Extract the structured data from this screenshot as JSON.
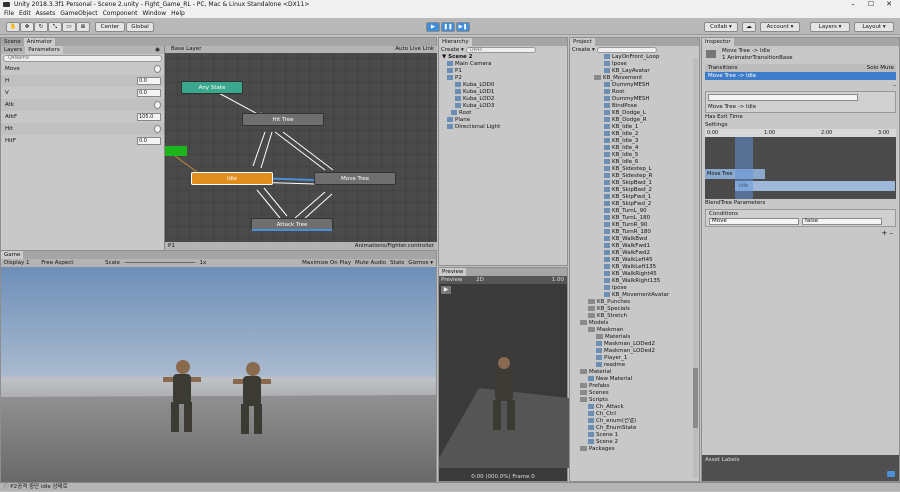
{
  "window": {
    "title": "Unity 2018.3.3f1 Personal - Scene 2.unity - Fight_Game_RL - PC, Mac & Linux Standalone <DX11>",
    "min": "–",
    "max": "☐",
    "close": "✕"
  },
  "menu": [
    "File",
    "Edit",
    "Assets",
    "GameObject",
    "Component",
    "Window",
    "Help"
  ],
  "toolbar": {
    "center": "Center",
    "global": "Global",
    "collab": "Collab ▾",
    "account": "Account ▾",
    "layers": "Layers ▾",
    "layout": "Layout ▾"
  },
  "animator": {
    "tabs": [
      "Scene",
      "Animator"
    ],
    "sub_tabs": [
      "Layers",
      "Parameters"
    ],
    "search_placeholder": "Q▾Name",
    "base_layer": "Base Layer",
    "auto_live": "Auto Live Link",
    "path": "P1",
    "controller": "Animations/Fighter.controller",
    "params": [
      {
        "name": "Move",
        "value": ""
      },
      {
        "name": "H",
        "value": "0.0"
      },
      {
        "name": "V",
        "value": "0.0"
      },
      {
        "name": "Atk",
        "value": ""
      },
      {
        "name": "AtkF",
        "value": "105.0"
      },
      {
        "name": "Hit",
        "value": ""
      },
      {
        "name": "HitF",
        "value": "0.0"
      }
    ],
    "nodes": {
      "any": "Any State",
      "hit": "Hit Tree",
      "idle": "Idle",
      "move": "Move Tree",
      "attack": "Attack Tree"
    }
  },
  "game": {
    "tab": "Game",
    "display": "Display 1",
    "aspect": "Free Aspect",
    "scale": "Scale",
    "scale_val": "1x",
    "opts": [
      "Maximize On Play",
      "Mute Audio",
      "Stats",
      "Gizmos ▾"
    ]
  },
  "hierarchy": {
    "tab": "Hierarchy",
    "create": "Create ▾",
    "search": "Q▾All",
    "scene": "Scene 2",
    "items": [
      "Main Camera",
      "P1",
      "P2",
      "Kuba_LOD0",
      "Kuba_LOD1",
      "Kuba_LOD2",
      "Kuba_LOD3",
      "Root",
      "Plane",
      "Directional Light"
    ]
  },
  "preview": {
    "tab": "Preview",
    "label": "Preview",
    "mode": "2D",
    "speed": "1.00",
    "status": "0:00 (000.0%) Frame 0"
  },
  "project": {
    "tab": "Project",
    "create": "Create ▾",
    "items": [
      "LayOnFront_Loop",
      "Ipose",
      "KB_LayAvatar",
      "KB_Movement",
      "DummyMESH",
      "Root",
      "DummyMESH",
      "BindPose",
      "KB_Dodge_L",
      "KB_Dodge_R",
      "KB_Idle_1",
      "KB_Idle_2",
      "KB_Idle_3",
      "KB_Idle_4",
      "KB_Idle_5",
      "KB_Idle_6",
      "KB_Sidestep_L",
      "KB_Sidestep_R",
      "KB_SkipBwd_1",
      "KB_SkipBwd_2",
      "KB_SkipFwd_1",
      "KB_SkipFwd_2",
      "KB_TurnL_90",
      "KB_TurnL_180",
      "KB_TurnR_90",
      "KB_TurnR_180",
      "KB_WalkBwd",
      "KB_WalkFwd1",
      "KB_WalkFwd2",
      "KB_WalkLeft45",
      "KB_WalkLeft135",
      "KB_WalkRight45",
      "KB_WalkRight135",
      "Ipose",
      "KB_MovementAvatar",
      "KB_Punches",
      "KB_Specials",
      "KB_Stretch",
      "Models",
      "Maskman",
      "Materials",
      "Maskman_LODed2",
      "Maskman_LODed2",
      "Player_1",
      "readme",
      "Material",
      "New Material",
      "Prefabs",
      "Scenes",
      "Scripts",
      "Ch_Attack",
      "Ch_Ctrl",
      "Ch_enum(전열)",
      "Ch_EnumState",
      "Scene 1",
      "Scene 2",
      "Packages"
    ]
  },
  "inspector": {
    "tab": "Inspector",
    "title": "Move Tree -> Idle",
    "subtitle": "1 AnimatorTransitionBase",
    "transitions": "Transitions",
    "solo": "Solo",
    "mute": "Mute",
    "row": "Move Tree -> Idle",
    "name": "Move Tree -> Idle",
    "has_exit": "Has Exit Time",
    "settings": "Settings",
    "ticks": [
      "0:00",
      "1:00",
      "2:00",
      "3:00"
    ],
    "tl_move": "Move Tree",
    "tl_idle": "Idle",
    "blend": "BlendTree Parameters",
    "conditions": "Conditions",
    "cond_param": "Move",
    "cond_val": "false",
    "plus": "+",
    "minus": "–",
    "asset_labels": "Asset Labels"
  },
  "status": {
    "text": "P2공격 중단 idle 상태로"
  }
}
